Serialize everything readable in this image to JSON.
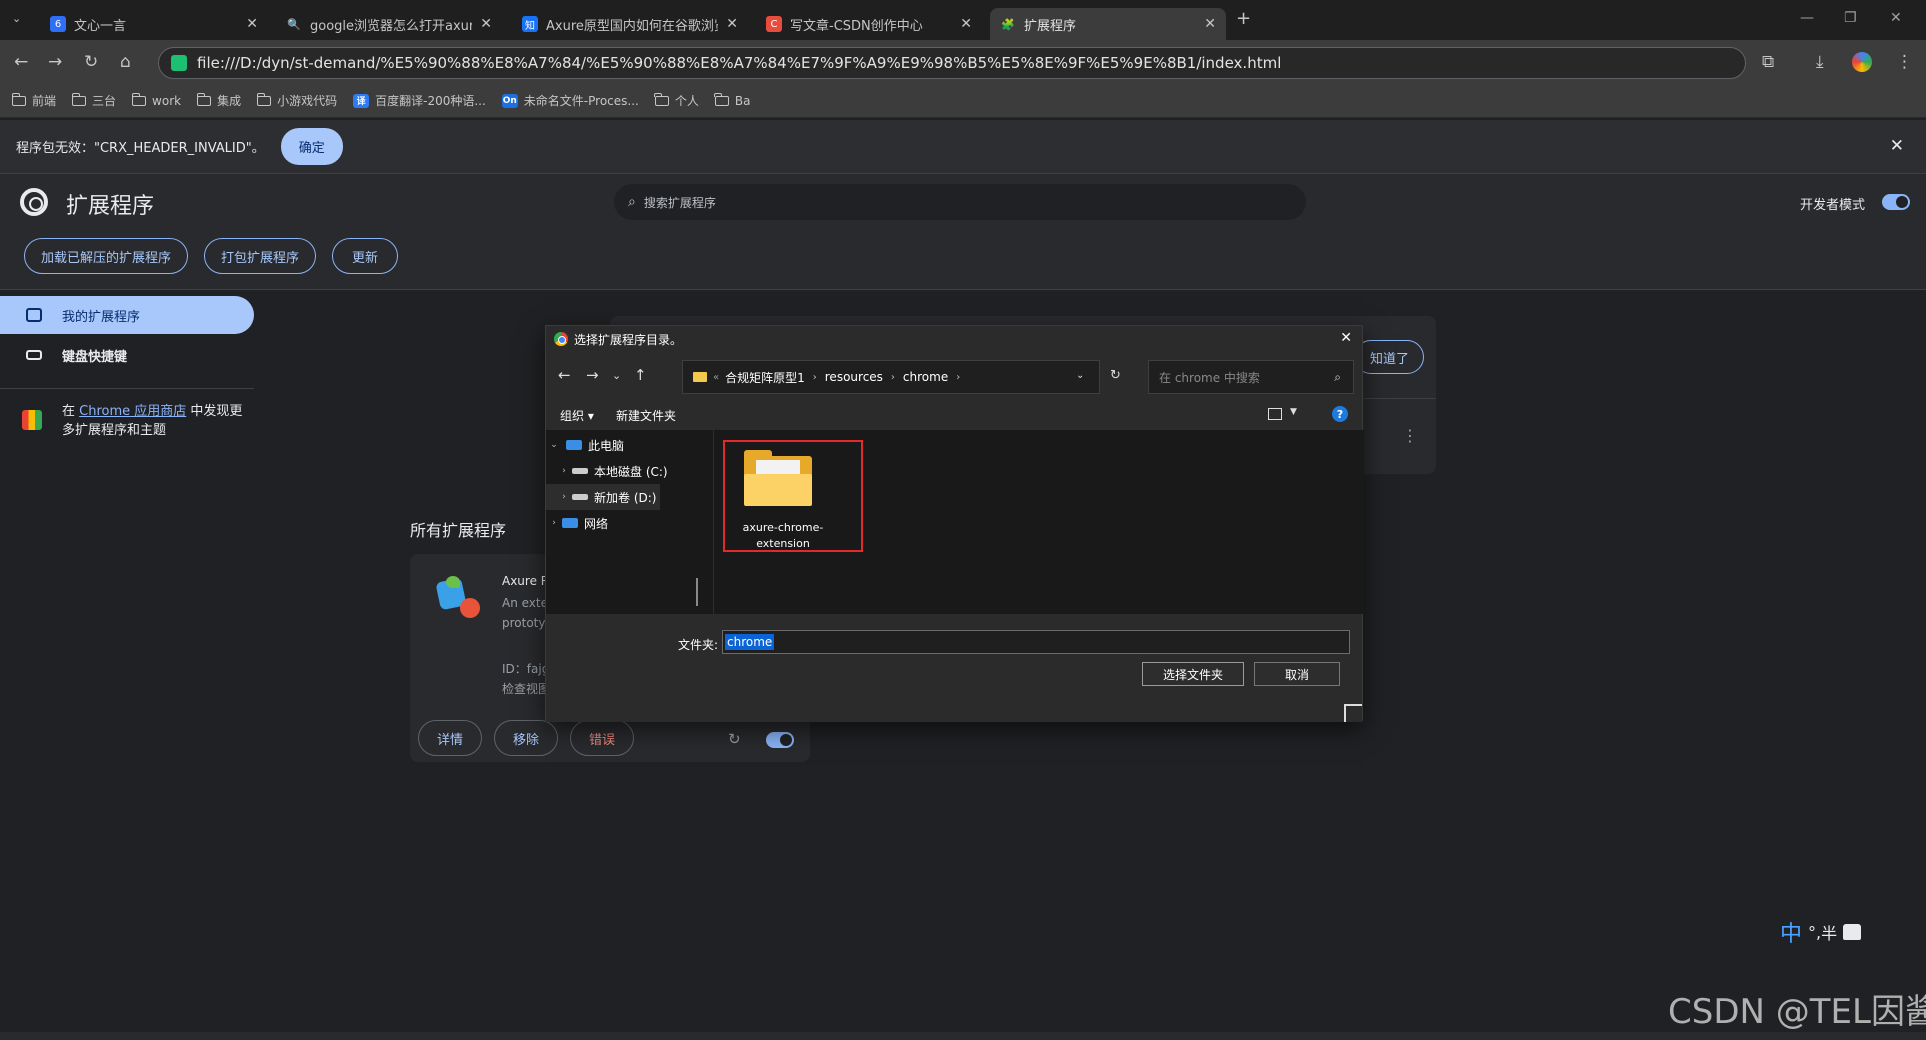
{
  "tabs": [
    {
      "title": "文心一言",
      "favicon_color": "#2f6ef6",
      "favicon_text": "6"
    },
    {
      "title": "google浏览器怎么打开axure的原型",
      "favicon_color": "",
      "favicon_text": "🔍"
    },
    {
      "title": "Axure原型国内如何在谷歌浏览器打开",
      "favicon_color": "#1772f6",
      "favicon_text": "知"
    },
    {
      "title": "写文章-CSDN创作中心",
      "favicon_color": "#e84c3d",
      "favicon_text": "C"
    },
    {
      "title": "扩展程序",
      "favicon_color": "",
      "favicon_text": "🧩"
    }
  ],
  "address": "file:///D:/dyn/st-demand/%E5%90%88%E8%A7%84/%E5%90%88%E8%A7%84%E7%9F%A9%E9%98%B5%E5%8E%9F%E5%9E%8B1/index.html",
  "bookmarks": [
    {
      "label": "前端",
      "kind": "folder"
    },
    {
      "label": "三台",
      "kind": "folder"
    },
    {
      "label": "work",
      "kind": "folder"
    },
    {
      "label": "集成",
      "kind": "folder"
    },
    {
      "label": "小游戏代码",
      "kind": "folder"
    },
    {
      "label": "百度翻译-200种语...",
      "kind": "badge",
      "badge": "译",
      "color": "#2d7cf6"
    },
    {
      "label": "未命名文件-Proces...",
      "kind": "badge",
      "badge": "On",
      "color": "#1e6fe0"
    },
    {
      "label": "个人",
      "kind": "folder"
    },
    {
      "label": "Ba",
      "kind": "folder"
    }
  ],
  "infobar": {
    "message": "程序包无效：\"CRX_HEADER_INVALID\"。",
    "ok_label": "确定"
  },
  "ext_page": {
    "title": "扩展程序",
    "search_placeholder": "搜索扩展程序",
    "dev_mode_label": "开发者模式",
    "buttons": {
      "load_unpacked": "加载已解压的扩展程序",
      "pack": "打包扩展程序",
      "update": "更新"
    },
    "sidebar": {
      "my_extensions": "我的扩展程序",
      "keyboard_shortcuts": "键盘快捷键"
    },
    "webstore": {
      "prefix": "在 ",
      "link": "Chrome 应用商店",
      "suffix": " 中发现更多扩展程序和主题"
    },
    "got_it_label": "知道了",
    "all_extensions_title": "所有扩展程序",
    "card": {
      "name": "Axure RP Extension for Chrome",
      "desc_line1": "An extension that lets you view",
      "desc_line2": "prototypes",
      "id_line": "ID：fajgllgflgfbbcnlmjhpgjnlgabdkeh",
      "inspect_line": "检查视图",
      "details_label": "详情",
      "remove_label": "移除",
      "errors_label": "错误",
      "errors_color": "#f28b82"
    }
  },
  "dialog": {
    "title": "选择扩展程序目录。",
    "path": [
      "合规矩阵原型1",
      "resources",
      "chrome"
    ],
    "search_placeholder": "在 chrome 中搜索",
    "organize_label": "组织 ▾",
    "new_folder_label": "新建文件夹",
    "tree": [
      {
        "label": "此电脑",
        "chevron": "⌄",
        "icon_color": "#3a8ee6"
      },
      {
        "label": "本地磁盘 (C:)",
        "chevron": "›",
        "icon_color": "#cccccc"
      },
      {
        "label": "新加卷 (D:)",
        "chevron": "›",
        "icon_color": "#cccccc"
      },
      {
        "label": "网络",
        "chevron": "›",
        "icon_color": "#3a8ee6"
      }
    ],
    "folder_name_line1": "axure-chrome-",
    "folder_name_line2": "extension",
    "field_label": "文件夹:",
    "field_value": "chrome",
    "select_label": "选择文件夹",
    "cancel_label": "取消"
  },
  "ime": {
    "lang": "中",
    "punct": "°,",
    "width": "半"
  },
  "watermark": "CSDN @TEL因酱",
  "colors": {
    "accent": "#a8c7fa",
    "highlight": "#e32a2a",
    "folder": "#fcd267"
  }
}
